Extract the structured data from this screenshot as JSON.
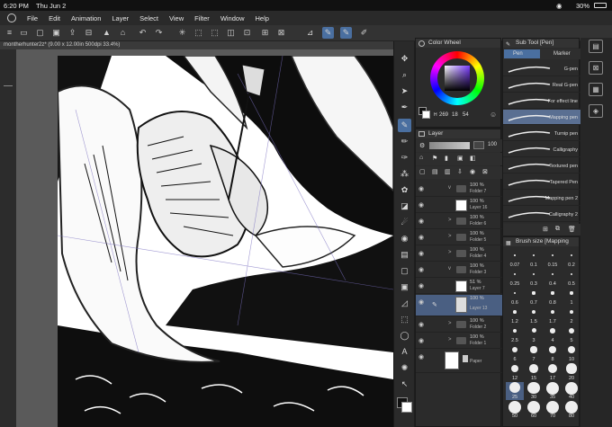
{
  "status_bar": {
    "time": "6:20 PM",
    "date": "Thu Jun 2",
    "battery": "30%"
  },
  "menu": [
    "File",
    "Edit",
    "Animation",
    "Layer",
    "Select",
    "View",
    "Filter",
    "Window",
    "Help"
  ],
  "document_tab": {
    "title": "montherhunter2z* (9.00 x 12.00in 500dpi 33.4%)"
  },
  "color_wheel": {
    "title": "Color Wheel",
    "h": "269",
    "s": "18",
    "v": "54"
  },
  "layer_panel": {
    "title": "Layer",
    "mode": "Normal",
    "opacity": "100",
    "layers": [
      {
        "opacity": "100 %",
        "name": "Folder 7",
        "kind": "folder",
        "arrow": "v"
      },
      {
        "opacity": "100 %",
        "name": "Layer 16",
        "kind": "layer",
        "arrow": ""
      },
      {
        "opacity": "100 %",
        "name": "Folder 6",
        "kind": "folder",
        "arrow": ">"
      },
      {
        "opacity": "100 %",
        "name": "Folder 5",
        "kind": "folder",
        "arrow": ">"
      },
      {
        "opacity": "100 %",
        "name": "Folder 4",
        "kind": "folder",
        "arrow": ">"
      },
      {
        "opacity": "100 %",
        "name": "Folder 3",
        "kind": "folder",
        "arrow": "v"
      },
      {
        "opacity": "51 %",
        "name": "Layer 7",
        "kind": "layer",
        "arrow": ""
      },
      {
        "opacity": "100 %",
        "name": "Layer 13",
        "kind": "layer",
        "arrow": "",
        "selected": true
      },
      {
        "opacity": "100 %",
        "name": "Folder 2",
        "kind": "folder",
        "arrow": ">"
      },
      {
        "opacity": "100 %",
        "name": "Folder 1",
        "kind": "folder",
        "arrow": ">"
      },
      {
        "opacity": "",
        "name": "Paper",
        "kind": "paper",
        "arrow": ""
      }
    ]
  },
  "sub_tool": {
    "title": "Sub Tool [Pen]",
    "tabs": [
      "Pen",
      "Marker"
    ],
    "brushes": [
      "G-pen",
      "Real G-pen",
      "For effect line",
      "Mapping pen",
      "Turnip pen",
      "Calligraphy",
      "Textured pen",
      "Tapered Pen",
      "Mapping pen 2",
      "Calligraphy 2"
    ],
    "selected_brush": "Mapping pen"
  },
  "brush_size": {
    "title": "Brush size [Mapping",
    "sizes": [
      "0.07",
      "0.1",
      "0.15",
      "0.2",
      "0.25",
      "0.3",
      "0.4",
      "0.5",
      "0.6",
      "0.7",
      "0.8",
      "1",
      "1.2",
      "1.5",
      "1.7",
      "2",
      "2.5",
      "3",
      "4",
      "5",
      "6",
      "7",
      "8",
      "10",
      "12",
      "15",
      "17",
      "20",
      "25",
      "30",
      "35",
      "40",
      "50",
      "60",
      "70",
      "80"
    ],
    "selected": "25"
  },
  "colors": {
    "accent": "#4a6fa0",
    "selected_layer": "#4a5f82"
  }
}
